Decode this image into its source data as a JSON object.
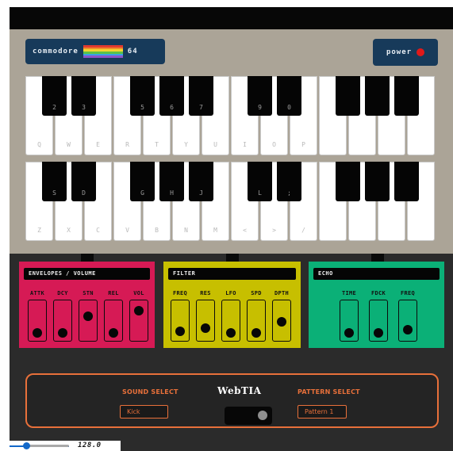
{
  "brand": {
    "name": "commodore",
    "model": "64",
    "stripe_colors": [
      "#e43a2f",
      "#f08d2a",
      "#f3d62e",
      "#5cc248",
      "#37a5e5",
      "#8d53c8"
    ]
  },
  "power": {
    "label": "power",
    "led_color": "#e11919"
  },
  "keyboard_upper": {
    "white_labels": [
      "Q",
      "W",
      "E",
      "R",
      "T",
      "Y",
      "U",
      "I",
      "O",
      "P",
      "",
      "",
      "",
      ""
    ],
    "black_labels": [
      "2",
      "3",
      "5",
      "6",
      "7",
      "9",
      "0",
      "",
      "",
      ""
    ]
  },
  "keyboard_lower": {
    "white_labels": [
      "Z",
      "X",
      "C",
      "V",
      "B",
      "N",
      "M",
      "<",
      ">",
      "/",
      "",
      "",
      "",
      ""
    ],
    "black_labels": [
      "S",
      "D",
      "G",
      "H",
      "J",
      "L",
      ";",
      "",
      "",
      ""
    ]
  },
  "envelopes": {
    "title": "ENVELOPES / VOLUME",
    "sliders": [
      {
        "label": "ATTK",
        "level": 0.1
      },
      {
        "label": "DCY",
        "level": 0.1
      },
      {
        "label": "STN",
        "level": 0.7
      },
      {
        "label": "REL",
        "level": 0.1
      },
      {
        "label": "VOL",
        "level": 0.9
      }
    ]
  },
  "filter": {
    "title": "FILTER",
    "sliders": [
      {
        "label": "FREQ",
        "level": 0.15
      },
      {
        "label": "RES",
        "level": 0.25
      },
      {
        "label": "LFO",
        "level": 0.1
      },
      {
        "label": "SPD",
        "level": 0.1
      },
      {
        "label": "DPTH",
        "level": 0.5
      }
    ]
  },
  "echo": {
    "title": "ECHO",
    "sliders": [
      {
        "label": "TIME",
        "level": 0.1
      },
      {
        "label": "FDCK",
        "level": 0.1
      },
      {
        "label": "FREQ",
        "level": 0.2
      }
    ]
  },
  "controls": {
    "sound_select_label": "SOUND SELECT",
    "sound_value": "Kick",
    "app_title": "WebTIA",
    "pattern_select_label": "PATTERN SELECT",
    "pattern_value": "Pattern 1",
    "accent_color": "#e8703a"
  },
  "tempo": {
    "value": "128.0",
    "level": 0.12
  }
}
